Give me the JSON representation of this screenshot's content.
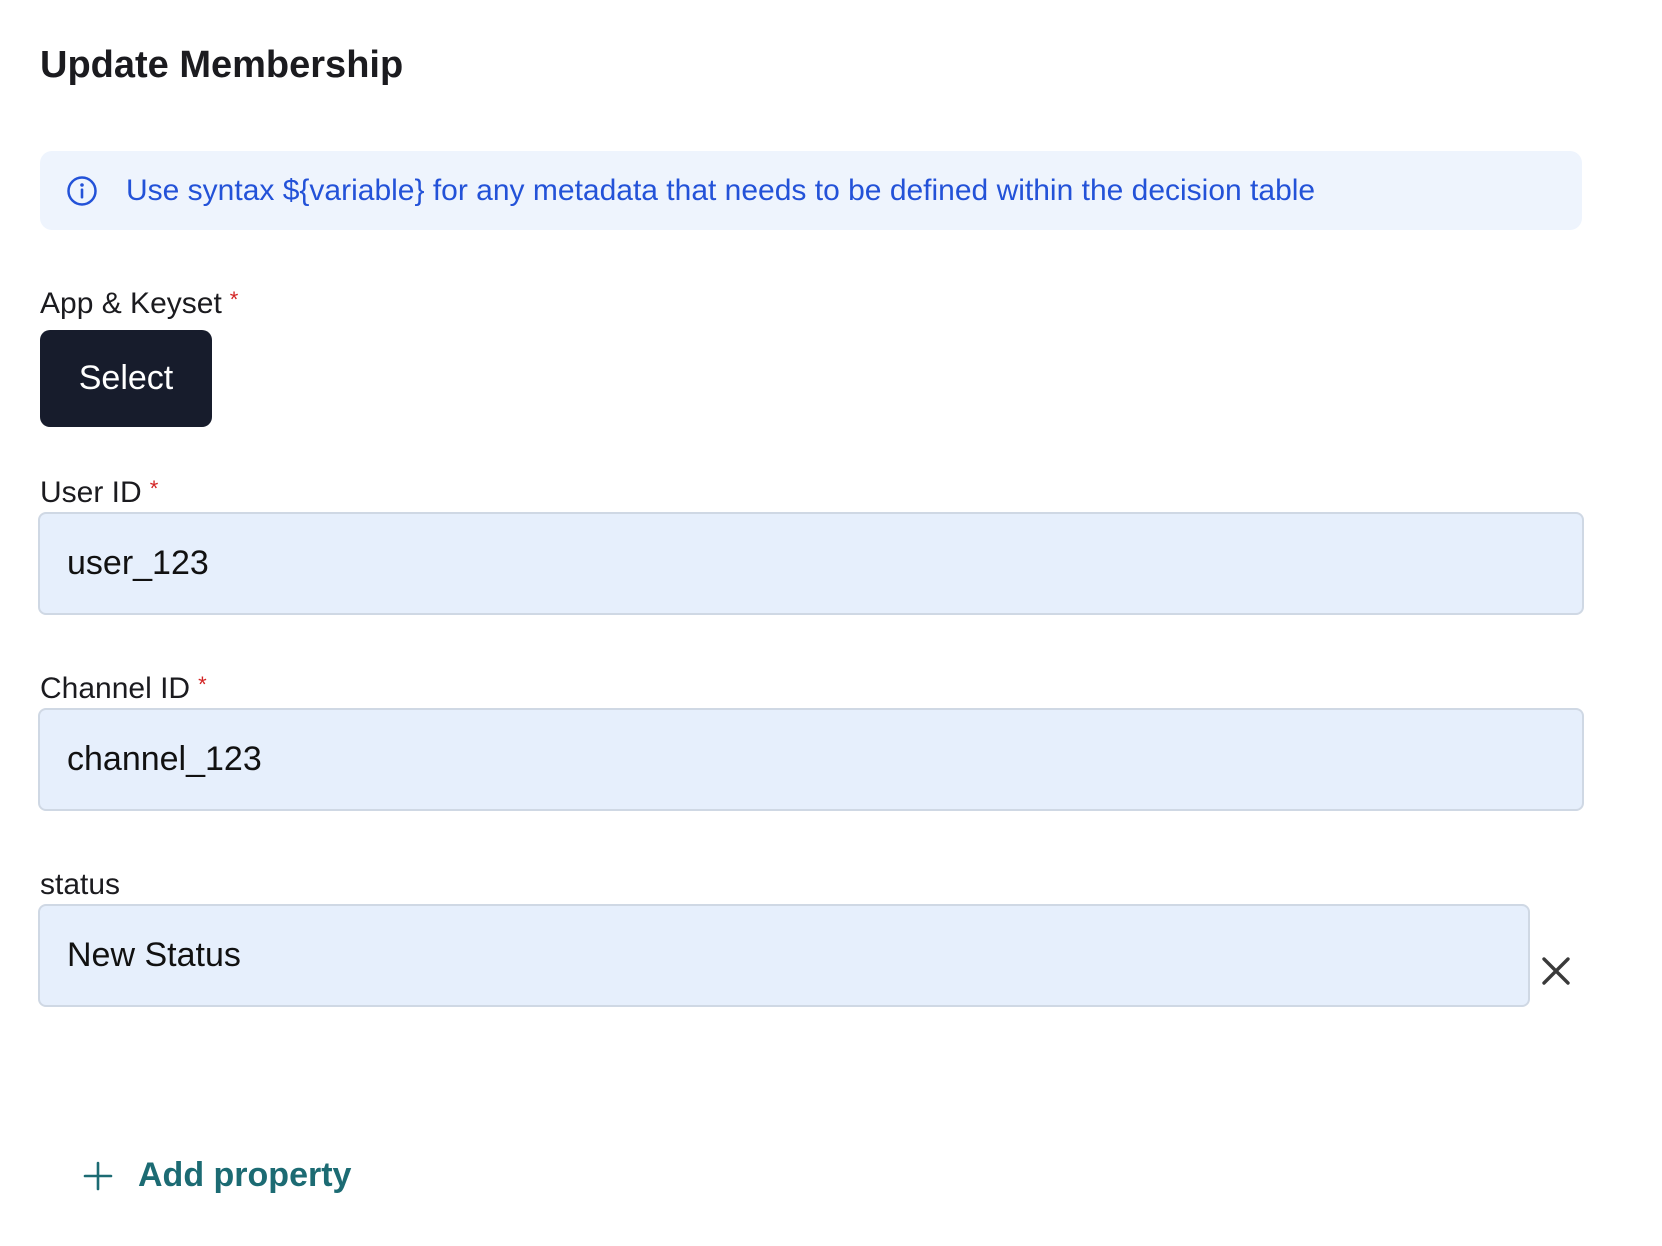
{
  "page": {
    "title": "Update Membership"
  },
  "info_banner": {
    "icon": "info-circle-icon",
    "text": "Use syntax ${variable} for any metadata that needs to be defined within the decision table"
  },
  "app_keyset": {
    "label": "App & Keyset",
    "required_marker": "*",
    "button_label": "Select"
  },
  "user_id": {
    "label": "User ID",
    "required_marker": "*",
    "value": "user_123"
  },
  "channel_id": {
    "label": "Channel ID",
    "required_marker": "*",
    "value": "channel_123"
  },
  "status": {
    "label": "status",
    "value": "New Status",
    "clear_icon": "close-icon"
  },
  "add_property": {
    "icon": "plus-icon",
    "label": "Add property"
  },
  "colors": {
    "info_text": "#2352d8",
    "info_background": "#eef4fd",
    "select_button": "#171c2c",
    "input_background": "#e6effc",
    "required_marker": "#d32424",
    "add_property": "#1c6b73"
  }
}
